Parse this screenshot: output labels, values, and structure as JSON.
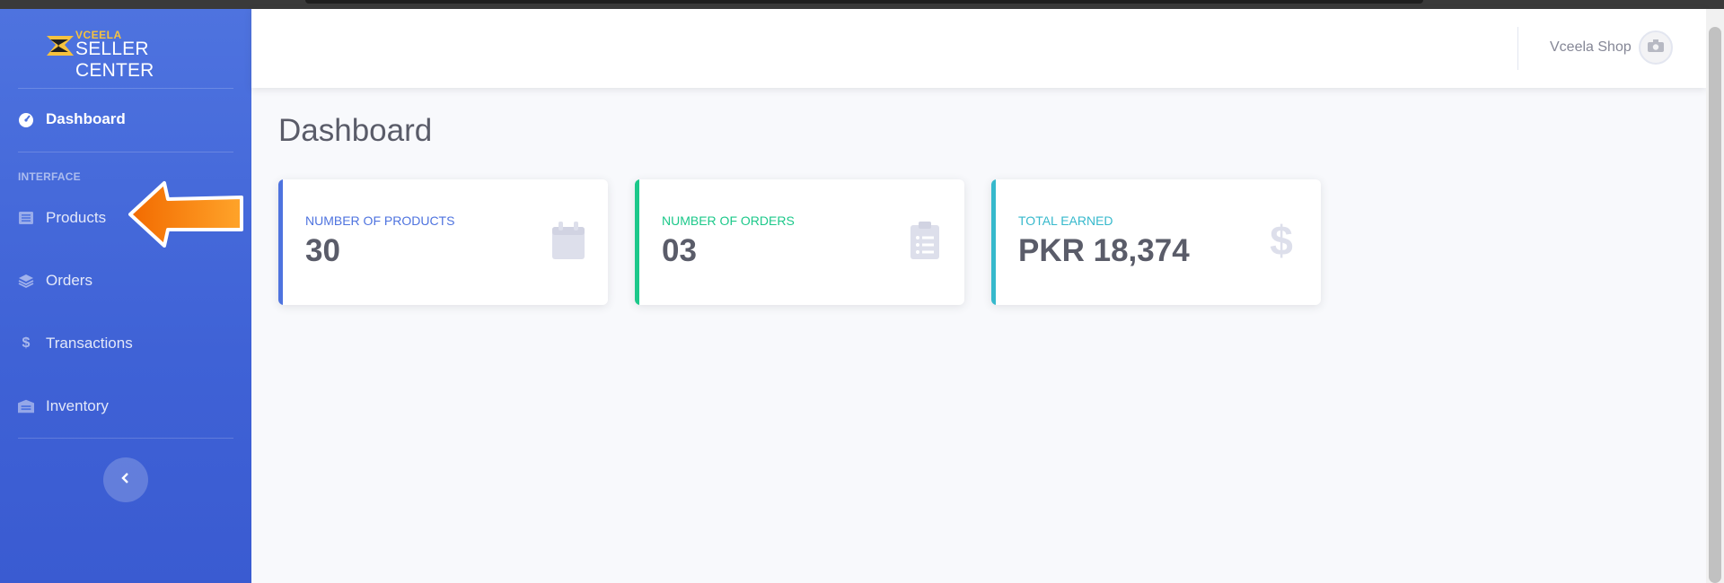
{
  "brand": {
    "top": "VCEELA",
    "bottom": "SELLER CENTER"
  },
  "sidebar": {
    "dashboard_label": "Dashboard",
    "section_label": "INTERFACE",
    "items": [
      {
        "label": "Products",
        "icon": "list-icon"
      },
      {
        "label": "Orders",
        "icon": "layers-icon"
      },
      {
        "label": "Transactions",
        "icon": "dollar-icon"
      },
      {
        "label": "Inventory",
        "icon": "warehouse-icon"
      }
    ]
  },
  "topbar": {
    "user_name": "Vceela Shop"
  },
  "page": {
    "title": "Dashboard"
  },
  "cards": [
    {
      "label": "Number of Products",
      "value": "30",
      "icon": "calendar-icon",
      "color": "#4e73df"
    },
    {
      "label": "Number of Orders",
      "value": "03",
      "icon": "clipboard-list-icon",
      "color": "#1cc88a"
    },
    {
      "label": "Total Earned",
      "value": "PKR 18,374",
      "icon": "dollar-icon",
      "color": "#36b9cc"
    }
  ],
  "colors": {
    "primary": "#4e73df",
    "success": "#1cc88a",
    "info": "#36b9cc",
    "arrow": "#f97d00"
  }
}
